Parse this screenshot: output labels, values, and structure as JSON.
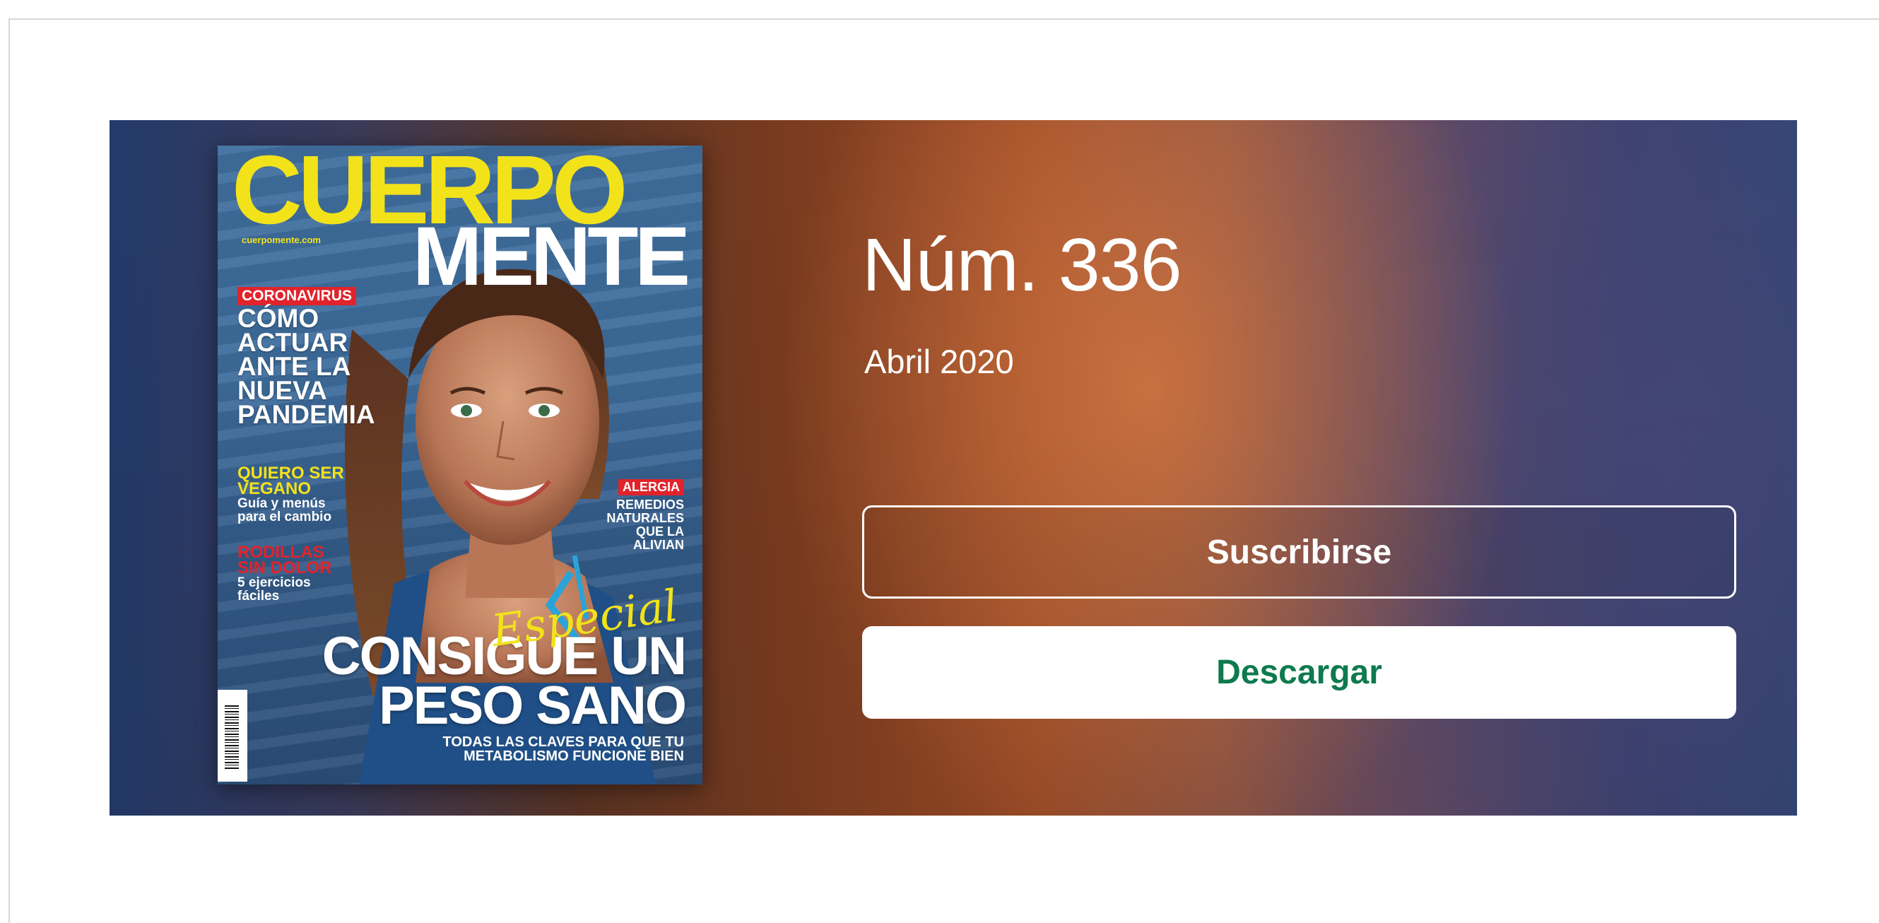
{
  "issue": {
    "number_label": "Núm. 336",
    "date_label": "Abril 2020"
  },
  "actions": {
    "subscribe_label": "Suscribirse",
    "download_label": "Descargar"
  },
  "cover": {
    "logo_top": "CUERPO",
    "logo_bottom": "MENTE",
    "site": "cuerpomente.com",
    "coronavirus_tag": "CORONAVIRUS",
    "coronavirus_headline": "CÓMO\nACTUAR\nANTE LA\nNUEVA\nPANDEMIA",
    "vegano_title": "QUIERO SER\nVEGANO",
    "vegano_sub": "Guía y menús\npara el cambio",
    "rodillas_title": "RODILLAS\nSIN DOLOR",
    "rodillas_sub": "5 ejercicios\nfáciles",
    "alergia_tag": "ALERGIA",
    "alergia_text": "REMEDIOS\nNATURALES\nQUE LA\nALIVIAN",
    "especial": "Especial",
    "main_headline": "CONSIGUE UN\nPESO SANO",
    "main_sub": "TODAS LAS CLAVES PARA QUE TU\nMETABOLISMO FUNCIONE BIEN"
  },
  "colors": {
    "download_text": "#0d7a4f",
    "cover_yellow": "#f2e21a",
    "cover_red": "#e2232b"
  }
}
